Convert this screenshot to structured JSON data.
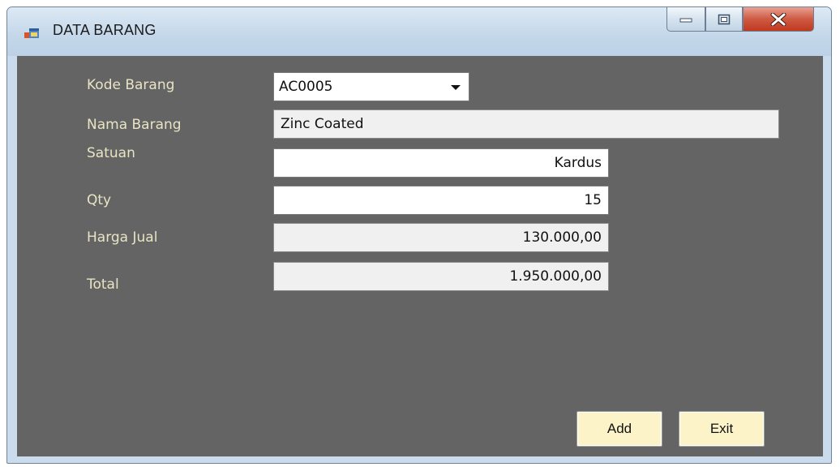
{
  "window": {
    "title": "DATA BARANG"
  },
  "labels": {
    "kode_barang": "Kode Barang",
    "nama_barang": "Nama Barang",
    "satuan": "Satuan",
    "qty": "Qty",
    "harga_jual": "Harga Jual",
    "total": "Total"
  },
  "fields": {
    "kode_barang": "AC0005",
    "nama_barang": "Zinc Coated",
    "satuan": "Kardus",
    "qty": "15",
    "harga_jual": "130.000,00",
    "total": "1.950.000,00"
  },
  "buttons": {
    "add": "Add",
    "exit": "Exit"
  },
  "icons": {
    "app": "window-app-icon",
    "minimize": "minimize-icon",
    "maximize": "maximize-icon",
    "close": "close-icon",
    "dropdown": "chevron-down-icon"
  },
  "colors": {
    "client_background": "#646464",
    "label_text": "#e8e4c4",
    "button_face": "#fdf3c8",
    "close_button": "#c0391f"
  }
}
